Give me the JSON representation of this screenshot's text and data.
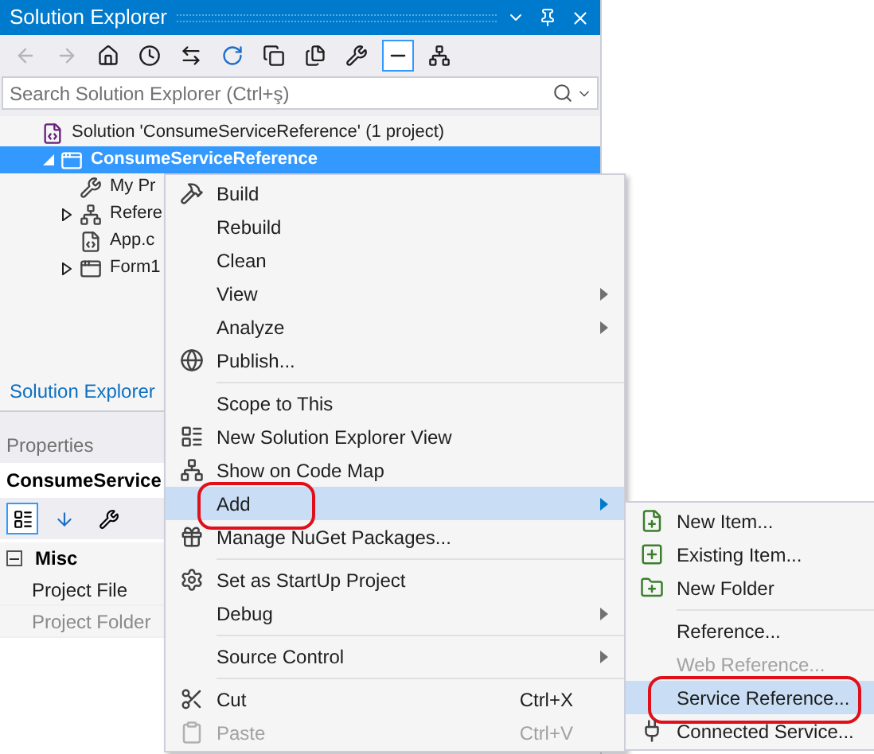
{
  "solution_explorer": {
    "title": "Solution Explorer",
    "toolbar": [
      {
        "disabled": true,
        "selected": false
      },
      {
        "disabled": true,
        "selected": false
      },
      {
        "disabled": false,
        "selected": false
      },
      {
        "disabled": false,
        "selected": false
      },
      {
        "disabled": false,
        "selected": false
      },
      {
        "disabled": false,
        "selected": false
      },
      {
        "disabled": false,
        "selected": false
      },
      {
        "disabled": false,
        "selected": false
      },
      {
        "disabled": false,
        "selected": false
      },
      {
        "disabled": false,
        "selected": true
      },
      {
        "disabled": false,
        "selected": false
      }
    ],
    "search": {
      "placeholder": "Search Solution Explorer (Ctrl+ş)"
    },
    "tree": [
      {
        "label": "Solution 'ConsumeServiceReference' (1 project)",
        "selected": false,
        "children": [
          {
            "label": "ConsumeServiceReference",
            "selected": true,
            "expanded": true,
            "children": [
              {
                "label": "My Pr",
                "selected": false
              },
              {
                "label": "Refere",
                "selected": false,
                "expanded": false
              },
              {
                "label": "App.c",
                "selected": false
              },
              {
                "label": "Form1",
                "selected": false,
                "expanded": false
              }
            ]
          }
        ]
      }
    ],
    "bottom_tab": "Solution Explorer"
  },
  "properties": {
    "title": "Properties",
    "object": "ConsumeService",
    "category": {
      "label": "Misc",
      "expanded": true
    },
    "rows": [
      {
        "label": "Project File",
        "disabled": false
      },
      {
        "label": "Project Folder",
        "disabled": true
      }
    ]
  },
  "context_menu": {
    "items": [
      {
        "kind": "item",
        "label": "Build",
        "submenu": false,
        "disabled": false,
        "selected": false
      },
      {
        "kind": "item",
        "label": "Rebuild",
        "submenu": false,
        "disabled": false,
        "selected": false
      },
      {
        "kind": "item",
        "label": "Clean",
        "submenu": false,
        "disabled": false,
        "selected": false
      },
      {
        "kind": "item",
        "label": "View",
        "submenu": true,
        "disabled": false,
        "selected": false
      },
      {
        "kind": "item",
        "label": "Analyze",
        "submenu": true,
        "disabled": false,
        "selected": false
      },
      {
        "kind": "item",
        "label": "Publish...",
        "submenu": false,
        "disabled": false,
        "selected": false
      },
      {
        "kind": "separator"
      },
      {
        "kind": "item",
        "label": "Scope to This",
        "submenu": false,
        "disabled": false,
        "selected": false
      },
      {
        "kind": "item",
        "label": "New Solution Explorer View",
        "submenu": false,
        "disabled": false,
        "selected": false
      },
      {
        "kind": "item",
        "label": "Show on Code Map",
        "submenu": false,
        "disabled": false,
        "selected": false
      },
      {
        "kind": "item",
        "label": "Add",
        "submenu": true,
        "disabled": false,
        "selected": true,
        "circled": true
      },
      {
        "kind": "item",
        "label": "Manage NuGet Packages...",
        "submenu": false,
        "disabled": false,
        "selected": false
      },
      {
        "kind": "separator"
      },
      {
        "kind": "item",
        "label": "Set as StartUp Project",
        "submenu": false,
        "disabled": false,
        "selected": false
      },
      {
        "kind": "item",
        "label": "Debug",
        "submenu": true,
        "disabled": false,
        "selected": false
      },
      {
        "kind": "separator"
      },
      {
        "kind": "item",
        "label": "Source Control",
        "submenu": true,
        "disabled": false,
        "selected": false
      },
      {
        "kind": "separator"
      },
      {
        "kind": "item",
        "label": "Cut",
        "shortcut": "Ctrl+X",
        "submenu": false,
        "disabled": false,
        "selected": false
      },
      {
        "kind": "item",
        "label": "Paste",
        "shortcut": "Ctrl+V",
        "submenu": false,
        "disabled": true,
        "selected": false
      }
    ]
  },
  "add_submenu": {
    "items": [
      {
        "kind": "item",
        "label": "New Item...",
        "disabled": false,
        "selected": false
      },
      {
        "kind": "item",
        "label": "Existing Item...",
        "disabled": false,
        "selected": false
      },
      {
        "kind": "item",
        "label": "New Folder",
        "disabled": false,
        "selected": false
      },
      {
        "kind": "separator"
      },
      {
        "kind": "item",
        "label": "Reference...",
        "disabled": false,
        "selected": false
      },
      {
        "kind": "item",
        "label": "Web Reference...",
        "disabled": true,
        "selected": false
      },
      {
        "kind": "item",
        "label": "Service Reference...",
        "disabled": false,
        "selected": true,
        "circled": true
      },
      {
        "kind": "item",
        "label": "Connected Service...",
        "disabled": false,
        "selected": false
      }
    ]
  }
}
